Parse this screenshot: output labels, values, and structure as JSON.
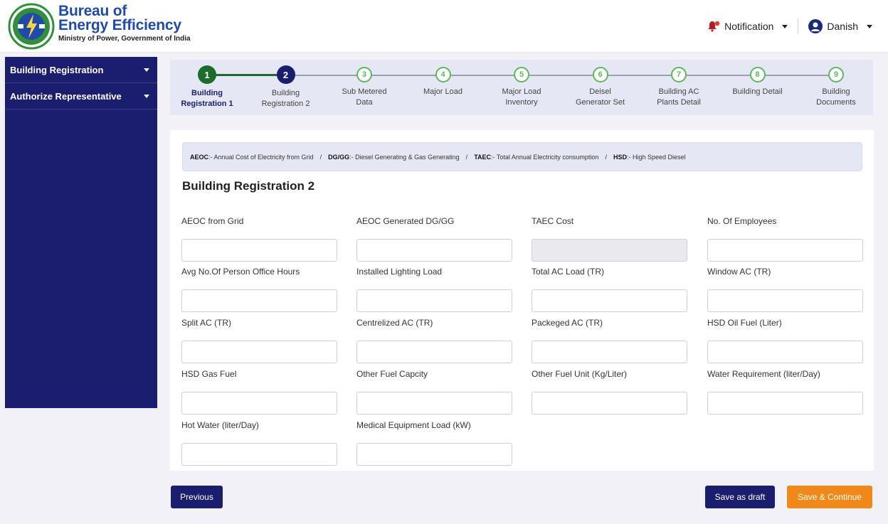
{
  "header": {
    "brand_line1": "Bureau of",
    "brand_line2": "Energy Efficiency",
    "brand_sub": "Ministry of Power, Government of India",
    "notification_label": "Notification",
    "user_label": "Danish",
    "brand_color": "#1f4aa8"
  },
  "sidebar": {
    "items": [
      {
        "label": "Building Registration",
        "icon": "chevron-down-icon"
      },
      {
        "label": "Authorize Representative",
        "icon": "chevron-down-icon"
      }
    ],
    "bg_color": "#1b1d6e"
  },
  "stepper": {
    "steps": [
      {
        "num": "1",
        "label_1": "Building",
        "label_2": "Registration 1",
        "state": "done"
      },
      {
        "num": "2",
        "label_1": "Building",
        "label_2": "Registration 2",
        "state": "active"
      },
      {
        "num": "3",
        "label_1": "Sub Metered",
        "label_2": "Data",
        "state": "todo"
      },
      {
        "num": "4",
        "label_1": "Major Load",
        "label_2": "",
        "state": "todo"
      },
      {
        "num": "5",
        "label_1": "Major Load",
        "label_2": "Inventory",
        "state": "todo"
      },
      {
        "num": "6",
        "label_1": "Deisel",
        "label_2": "Generator Set",
        "state": "todo"
      },
      {
        "num": "7",
        "label_1": "Building AC",
        "label_2": "Plants Detail",
        "state": "todo"
      },
      {
        "num": "8",
        "label_1": "Building Detail",
        "label_2": "",
        "state": "todo"
      },
      {
        "num": "9",
        "label_1": "Building",
        "label_2": "Documents",
        "state": "todo"
      }
    ]
  },
  "legend": {
    "k1": "AEOC",
    "v1": ":- Annual Cost of Electricity from Grid",
    "k2": "DG/GG",
    "v2": ":- Diesel Generating & Gas Generating",
    "k3": "TAEC",
    "v3": ":- Total Annual Electricity consumption",
    "k4": "HSD",
    "v4": ":- High Speed Diesel",
    "separator": "/"
  },
  "form": {
    "title": "Building Registration 2",
    "fields": [
      {
        "label": "AEOC from Grid",
        "value": ""
      },
      {
        "label": "AEOC Generated DG/GG",
        "value": ""
      },
      {
        "label": "TAEC Cost",
        "value": ""
      },
      {
        "label": "No. Of Employees",
        "value": ""
      },
      {
        "label": "Avg No.Of Person Office Hours",
        "value": ""
      },
      {
        "label": "Installed Lighting Load",
        "value": ""
      },
      {
        "label": "Total AC Load (TR)",
        "value": ""
      },
      {
        "label": "Window AC (TR)",
        "value": ""
      },
      {
        "label": "Split AC (TR)",
        "value": ""
      },
      {
        "label": "Centrelized AC (TR)",
        "value": ""
      },
      {
        "label": "Packeged AC (TR)",
        "value": ""
      },
      {
        "label": "HSD Oil Fuel (Liter)",
        "value": ""
      },
      {
        "label": "HSD Gas Fuel",
        "value": ""
      },
      {
        "label": "Other Fuel Capcity",
        "value": ""
      },
      {
        "label": "Other Fuel Unit (Kg/Liter)",
        "value": ""
      },
      {
        "label": "Water Requirement (liter/Day)",
        "value": ""
      },
      {
        "label": "Hot Water (liter/Day)",
        "value": ""
      },
      {
        "label": "Medical Equipment Load (kW)",
        "value": ""
      }
    ]
  },
  "buttons": {
    "previous": "Previous",
    "save_draft": "Save as draft",
    "save_continue": "Save & Continue",
    "accent_orange": "#f0891a"
  }
}
